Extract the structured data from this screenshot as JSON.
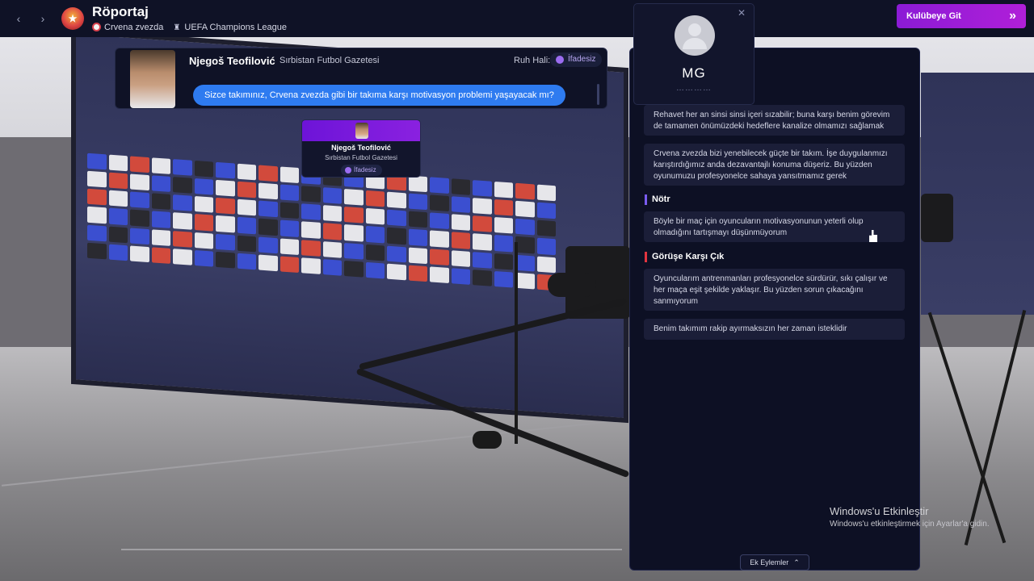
{
  "topbar": {
    "back_icon": "‹",
    "forward_icon": "›",
    "title": "Röportaj",
    "club_name": "Crvena zvezda",
    "competition": "UEFA Champions League",
    "continue_label": "Kulübeye Git",
    "continue_icon": "»",
    "accent_color": "#8b1bd6"
  },
  "journalist": {
    "name": "Njegoš Teofilović",
    "outlet": "Sırbistan Futbol Gazetesi",
    "mood_label": "Ruh Hali:",
    "mood_value": "İfadesiz",
    "question": "Sizce takımınız, Crvena zvezda gibi bir takıma karşı motivasyon problemi yaşayacak mı?"
  },
  "journalist_card": {
    "name": "Njegoš Teofilović",
    "outlet": "Sırbistan Futbol Gazetesi",
    "mood": "İfadesiz"
  },
  "manager": {
    "initials": "MG",
    "subtitle": "…………"
  },
  "answers": {
    "group1": [
      "Rehavet her an sinsi sinsi içeri sızabilir; buna karşı benim görevim de tamamen önümüzdeki hedeflere kanalize olmamızı sağlamak",
      "Crvena zvezda bizi yenebilecek güçte bir takım. İşe duygulanmızı karıştırdığımız anda dezavantajlı konuma düşeriz. Bu yüzden oyunumuzu profesyonelce sahaya yansıtmamız gerek"
    ],
    "neutral_label": "Nötr",
    "neutral": [
      "Böyle bir maç için oyuncuların motivasyonunun yeterli olup olmadığını tartışmayı düşünmüyorum"
    ],
    "confront_label": "Görüşe Karşı Çık",
    "confront": [
      "Oyuncularım antrenmanları profesyonelce sürdürür, sıkı çalışır ve her maça eşit şekilde yaklaşır. Bu yüzden sorun çıkacağını sanmıyorum",
      "Benim takımım rakip ayırmaksızın her zaman isteklidir"
    ]
  },
  "footer": {
    "more_actions": "Ek Eylemler",
    "more_actions_icon": "⌃"
  },
  "watermark": {
    "line1": "Windows'u Etkinleştir",
    "line2": "Windows'u etkinleştirmek için Ayarlar'a gidin."
  }
}
